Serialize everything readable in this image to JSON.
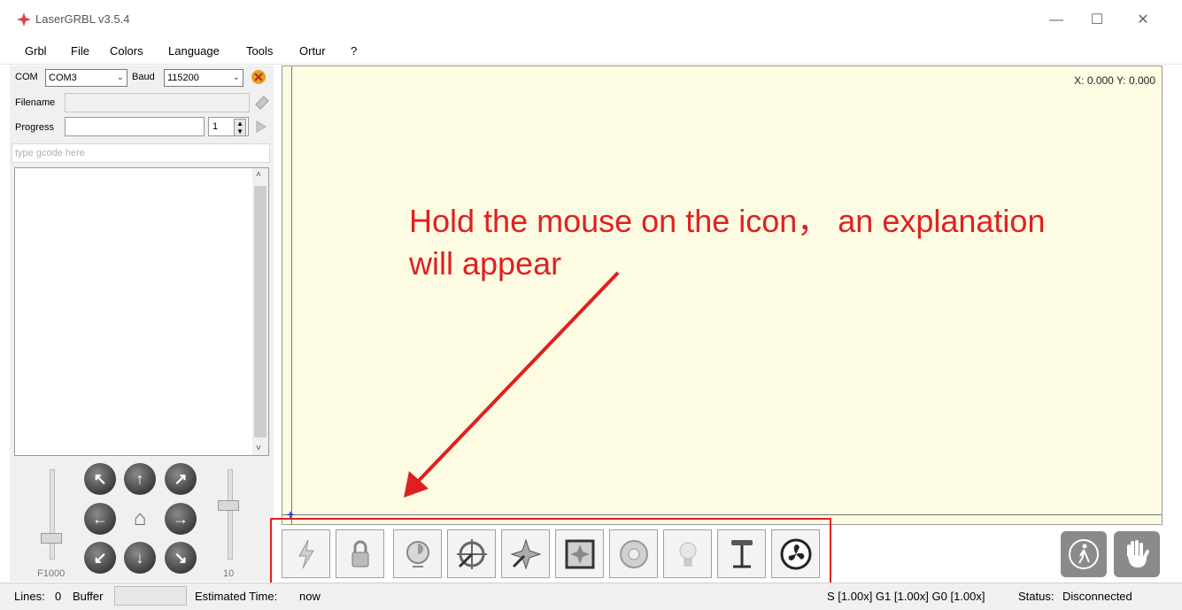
{
  "window": {
    "title": "LaserGRBL v3.5.4",
    "controls": [
      "—",
      "☐",
      "✕"
    ]
  },
  "menu": [
    "Grbl",
    "File",
    "Colors",
    "Language",
    "Tools",
    "Ortur",
    "?"
  ],
  "connection": {
    "com_label": "COM",
    "com_value": "COM3",
    "baud_label": "Baud",
    "baud_value": "115200"
  },
  "file": {
    "filename_label": "Filename",
    "filename_value": ""
  },
  "progress": {
    "label": "Progress",
    "value": 0,
    "count": "1"
  },
  "gcode": {
    "placeholder": "type gcode here"
  },
  "jog": {
    "feed_label": "F1000",
    "step_label": "10"
  },
  "canvas": {
    "coords": "X: 0.000 Y: 0.000",
    "background": "#fdfce3"
  },
  "annotation": {
    "line1": "Hold the mouse on the icon， an explanation",
    "line2": "will appear",
    "color": "#e02020"
  },
  "toolbar": {
    "buttons": [
      "grbl-reset-icon",
      "unlock-icon",
      "homing-icon",
      "center-icon",
      "corner-icon",
      "frame-icon",
      "focus-icon",
      "laser-icon",
      "z-probe-icon",
      "fan-icon"
    ]
  },
  "status": {
    "lines_label": "Lines:",
    "lines_value": "0",
    "buffer_label": "Buffer",
    "time_label": "Estimated Time:",
    "time_value": "now",
    "overrides": "S [1.00x] G1 [1.00x] G0 [1.00x]",
    "status_label": "Status:",
    "status_value": "Disconnected"
  }
}
